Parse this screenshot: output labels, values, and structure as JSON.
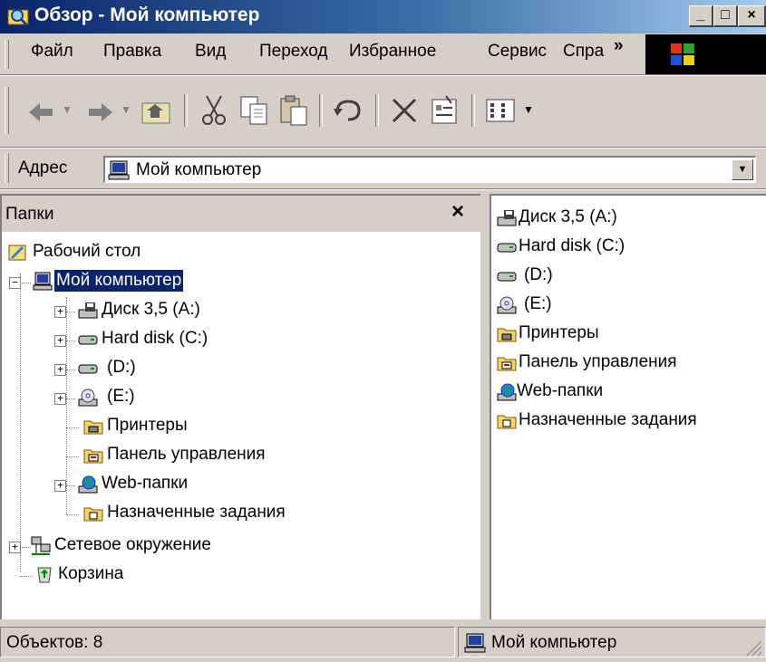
{
  "window": {
    "title": "Обзор - Мой компьютер"
  },
  "menu": [
    "Файл",
    "Правка",
    "Вид",
    "Переход",
    "Избранное",
    "Сервис",
    "Спра"
  ],
  "menu_overflow": "»",
  "address": {
    "label": "Адрес",
    "value": "Мой компьютер"
  },
  "folders_pane": {
    "title": "Папки",
    "close": "×"
  },
  "tree": {
    "desktop": "Рабочий стол",
    "my_computer": "Мой компьютер",
    "items": [
      "Диск 3,5 (A:)",
      "Hard disk (C:)",
      "(D:)",
      "(E:)",
      "Принтеры",
      "Панель управления",
      "Web-папки",
      "Назначенные задания"
    ],
    "network": "Сетевое окружение",
    "recycle": "Корзина"
  },
  "content_items": [
    "Диск 3,5 (A:)",
    "Hard disk (C:)",
    "(D:)",
    "(E:)",
    "Принтеры",
    "Панель управления",
    "Web-папки",
    "Назначенные задания"
  ],
  "status": {
    "objects": "Объектов: 8",
    "location": "Мой компьютер"
  }
}
